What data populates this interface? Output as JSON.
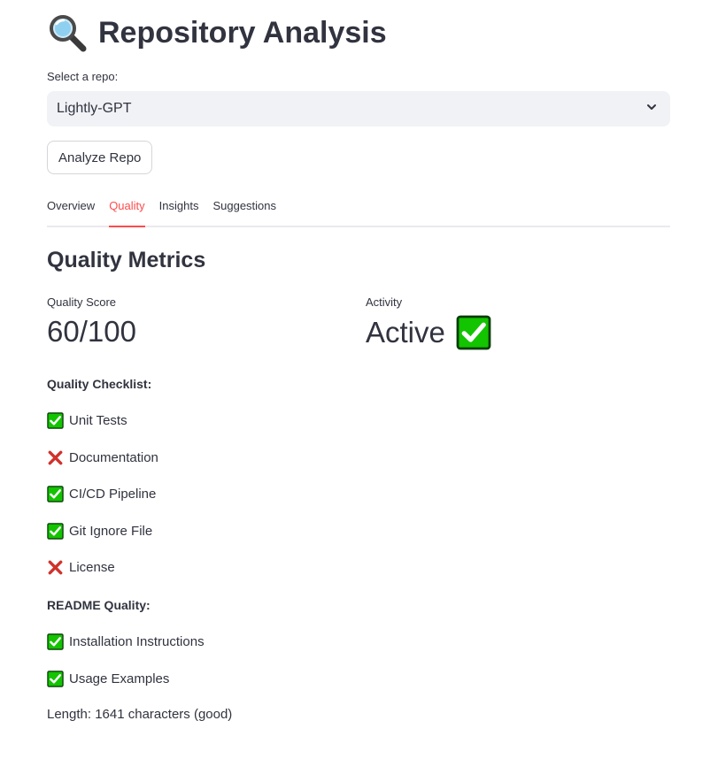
{
  "header": {
    "title": "Repository Analysis",
    "icon": "magnifier-icon"
  },
  "repo_select": {
    "label": "Select a repo:",
    "value": "Lightly-GPT"
  },
  "analyze_button": {
    "label": "Analyze Repo"
  },
  "tabs": [
    {
      "label": "Overview",
      "active": false
    },
    {
      "label": "Quality",
      "active": true
    },
    {
      "label": "Insights",
      "active": false
    },
    {
      "label": "Suggestions",
      "active": false
    }
  ],
  "section": {
    "title": "Quality Metrics"
  },
  "metrics": {
    "quality_score": {
      "label": "Quality Score",
      "value": "60/100"
    },
    "activity": {
      "label": "Activity",
      "value": "Active",
      "icon": "check-icon"
    }
  },
  "quality_checklist": {
    "heading": "Quality Checklist:",
    "items": [
      {
        "label": "Unit Tests",
        "status": "pass"
      },
      {
        "label": "Documentation",
        "status": "fail"
      },
      {
        "label": "CI/CD Pipeline",
        "status": "pass"
      },
      {
        "label": "Git Ignore File",
        "status": "pass"
      },
      {
        "label": "License",
        "status": "fail"
      }
    ]
  },
  "readme_quality": {
    "heading": "README Quality:",
    "items": [
      {
        "label": "Installation Instructions",
        "status": "pass"
      },
      {
        "label": "Usage Examples",
        "status": "pass"
      }
    ],
    "length_text": "Length: 1641 characters (good)"
  },
  "colors": {
    "accent": "#ff4b4b",
    "check_green": "#13c400",
    "cross_red": "#d0322b",
    "text": "#31333f"
  }
}
